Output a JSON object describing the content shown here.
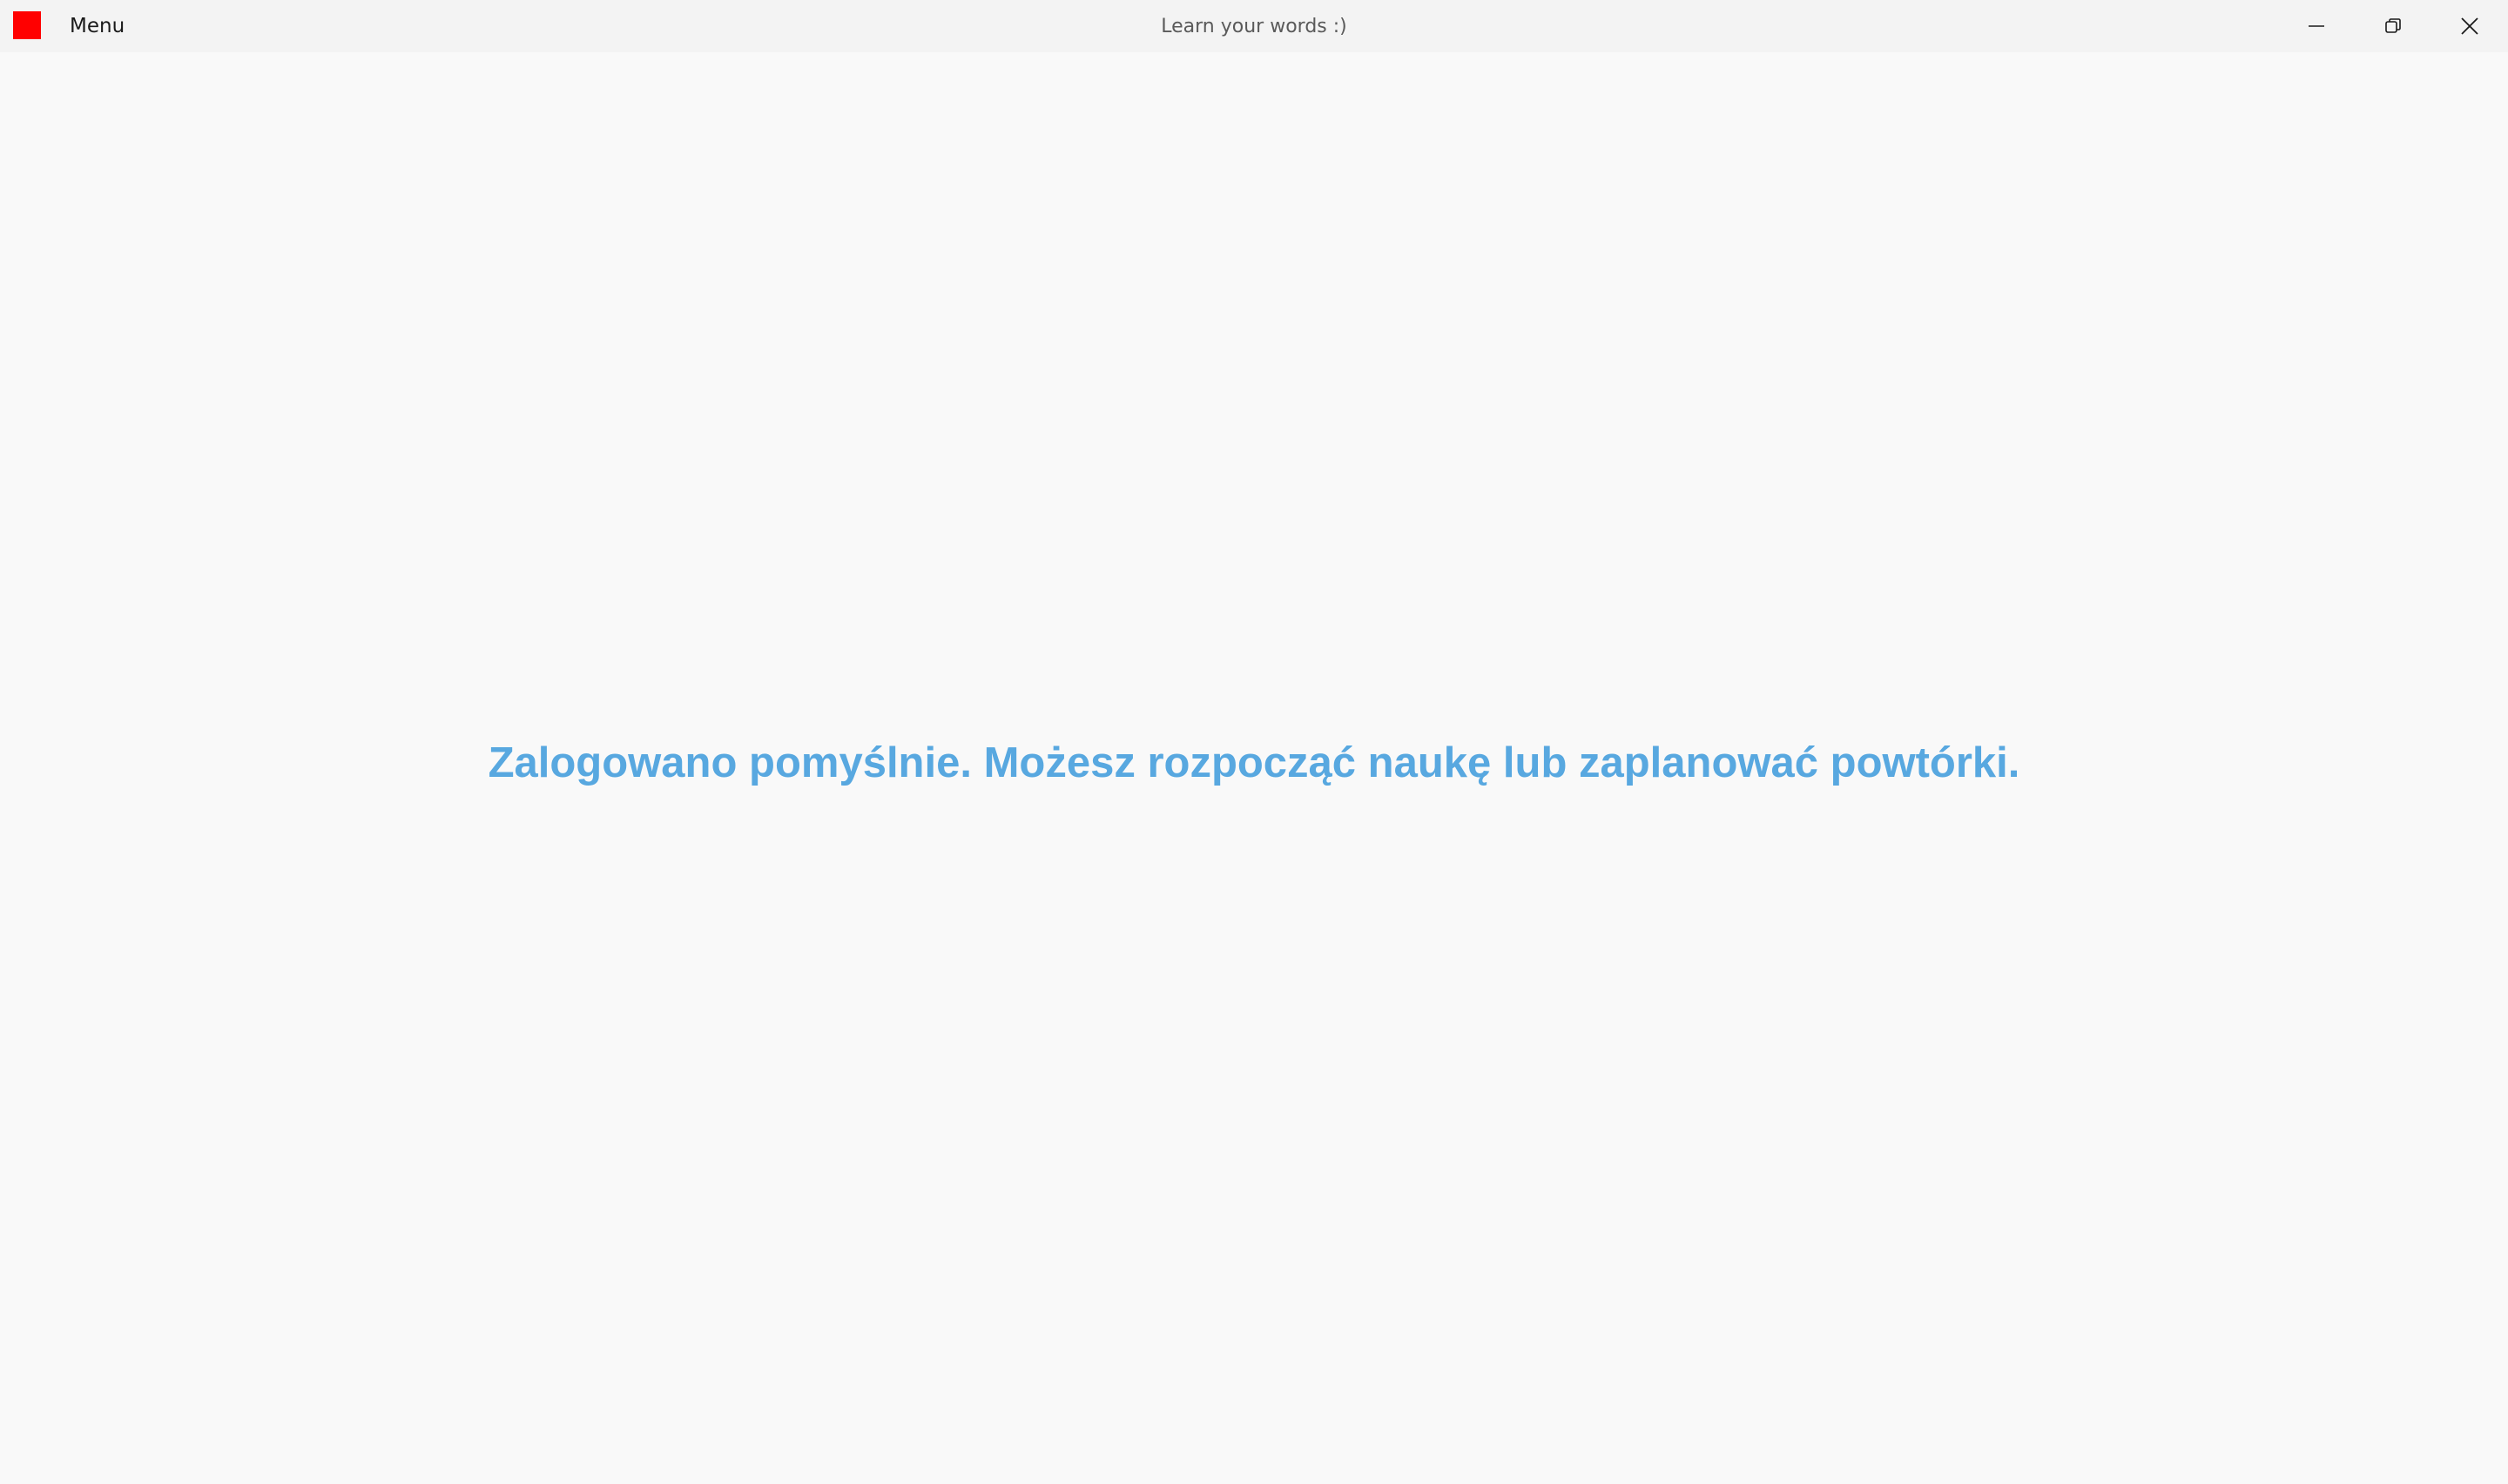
{
  "app": {
    "logo_color": "#ff0000",
    "menu_label": "Menu",
    "window_title": "Learn your words :)"
  },
  "window_controls": {
    "minimize_icon": "minimize-icon",
    "restore_icon": "restore-icon",
    "close_icon": "close-icon"
  },
  "main": {
    "message": "Zalogowano pomyślnie. Możesz rozpocząć naukę lub zaplanować powtórki.",
    "message_color": "#58a8e0"
  }
}
